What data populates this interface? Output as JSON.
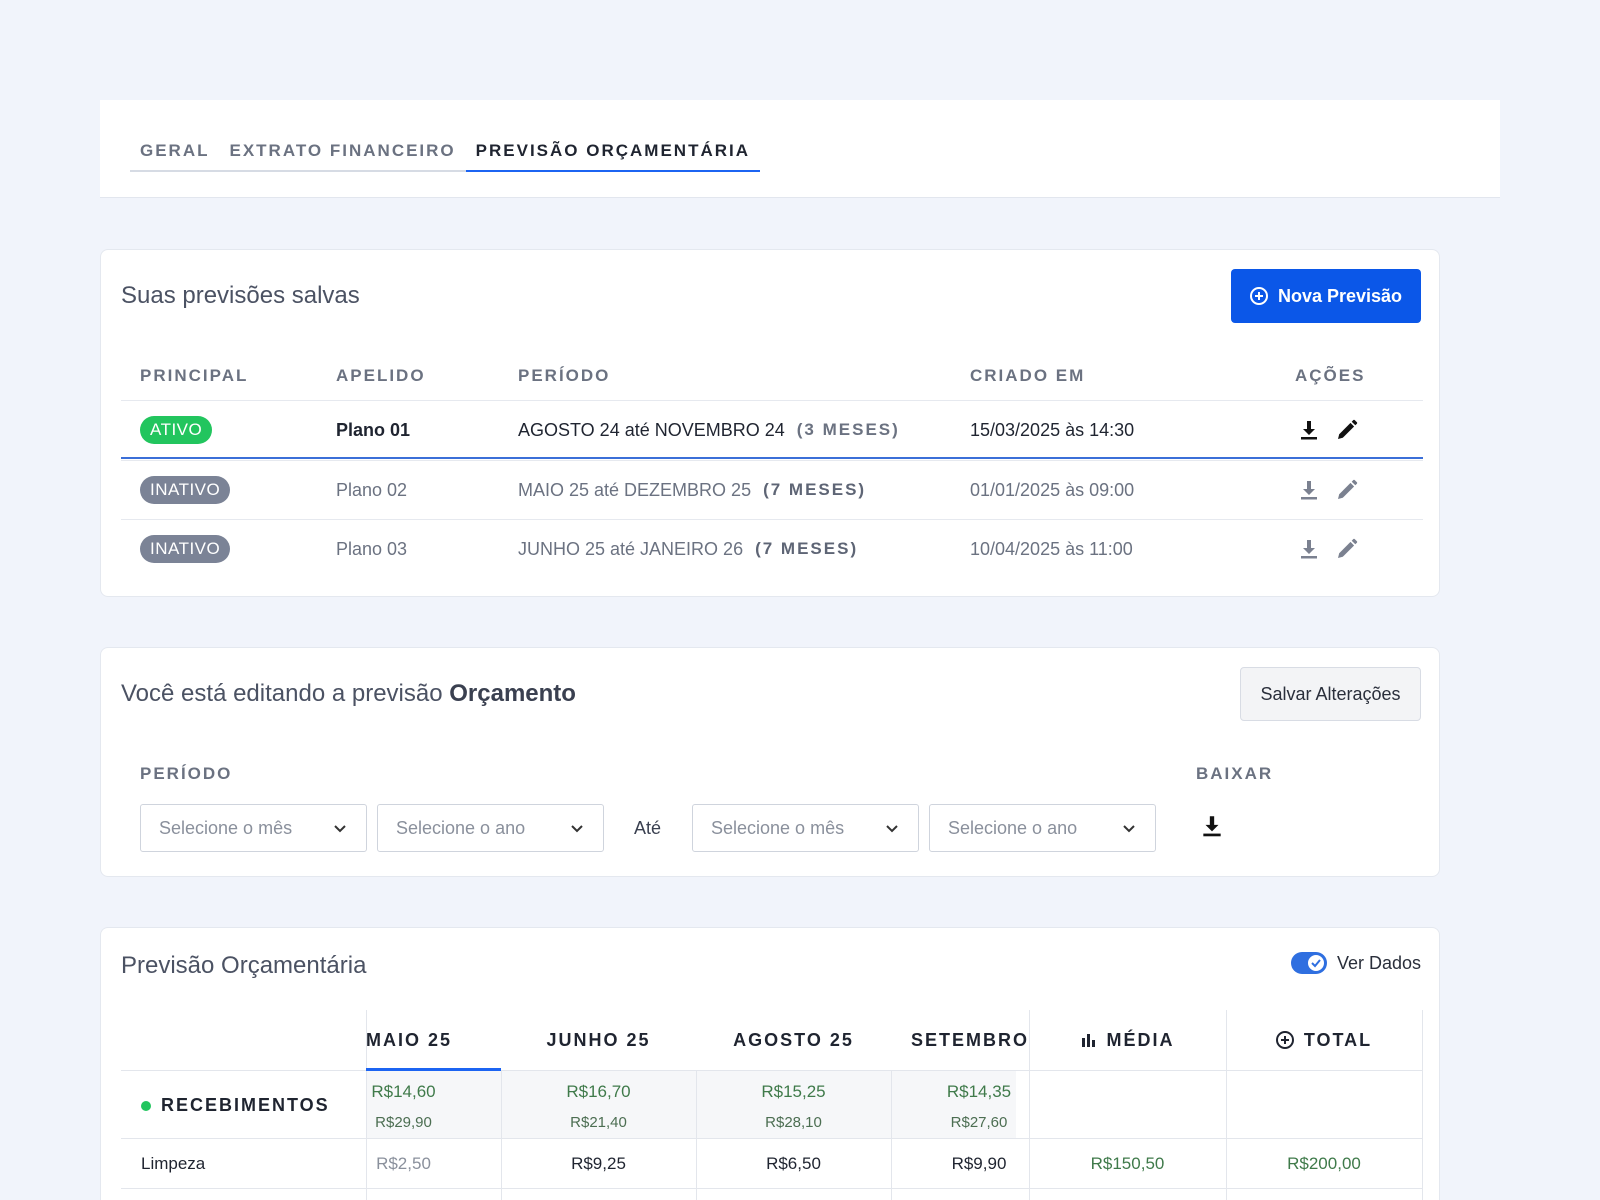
{
  "tabs": [
    {
      "label": "GERAL"
    },
    {
      "label": "EXTRATO FINANCEIRO"
    },
    {
      "label": "PREVISÃO ORÇAMENTÁRIA"
    }
  ],
  "saved": {
    "title": "Suas previsões salvas",
    "new_button": "Nova Previsão",
    "headers": {
      "principal": "PRINCIPAL",
      "apelido": "APELIDO",
      "periodo": "PERÍODO",
      "criado": "CRIADO EM",
      "acoes": "AÇÕES"
    },
    "rows": [
      {
        "status": "ATIVO",
        "name": "Plano 01",
        "period": "AGOSTO 24 até NOVEMBRO 24",
        "months": "(3 MESES)",
        "created": "15/03/2025 às 14:30"
      },
      {
        "status": "INATIVO",
        "name": "Plano 02",
        "period": "MAIO 25 até DEZEMBRO 25",
        "months": "(7 MESES)",
        "created": "01/01/2025 às 09:00"
      },
      {
        "status": "INATIVO",
        "name": "Plano 03",
        "period": "JUNHO 25 até JANEIRO 26",
        "months": "(7 MESES)",
        "created": "10/04/2025 às 11:00"
      }
    ]
  },
  "editing": {
    "prefix": "Você está editando a previsão",
    "name": "Orçamento",
    "save_button": "Salvar Alterações",
    "period_label": "PERÍODO",
    "download_label": "BAIXAR",
    "month_placeholder": "Selecione o mês",
    "year_placeholder": "Selecione o ano",
    "until": "Até"
  },
  "budget": {
    "title": "Previsão Orçamentária",
    "toggle_label": "Ver Dados",
    "columns": [
      "MAIO 25",
      "JUNHO 25",
      "AGOSTO 25",
      "SETEMBRO",
      "MÉDIA",
      "TOTAL"
    ],
    "receipts_label": "RECEBIMENTOS",
    "receipts": [
      {
        "main": "R$14,60",
        "sub": "R$29,90"
      },
      {
        "main": "R$16,70",
        "sub": "R$21,40"
      },
      {
        "main": "R$15,25",
        "sub": "R$28,10"
      },
      {
        "main": "R$14,35",
        "sub": "R$27,60"
      }
    ],
    "limpeza_label": "Limpeza",
    "limpeza": [
      "R$2,50",
      "R$9,25",
      "R$6,50",
      "R$9,90",
      "R$150,50",
      "R$200,00"
    ]
  },
  "colors": {
    "primary": "#0b57e8",
    "active_badge": "#22c55e",
    "inactive_badge": "#7b8396",
    "accent_line": "#1c64f2"
  },
  "icons": [
    "download-icon",
    "pencil-icon",
    "plus-circle-icon",
    "chevron-down-icon",
    "bar-chart-icon",
    "check-icon"
  ]
}
